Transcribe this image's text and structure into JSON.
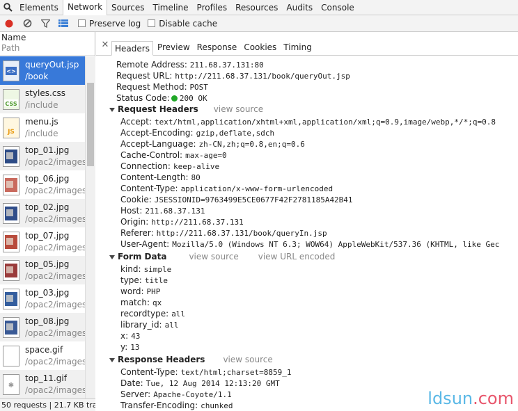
{
  "main_tabs": [
    {
      "label": "Elements"
    },
    {
      "label": "Network",
      "active": true
    },
    {
      "label": "Sources"
    },
    {
      "label": "Timeline"
    },
    {
      "label": "Profiles"
    },
    {
      "label": "Resources"
    },
    {
      "label": "Audits"
    },
    {
      "label": "Console"
    }
  ],
  "toolbar": {
    "preserve_log": "Preserve log",
    "disable_cache": "Disable cache"
  },
  "list_header": {
    "name": "Name",
    "path": "Path"
  },
  "requests": [
    {
      "name": "queryOut.jsp",
      "path": "/book",
      "icon": "html-file-icon",
      "selected": true
    },
    {
      "name": "styles.css",
      "path": "/include",
      "icon": "css-file-icon"
    },
    {
      "name": "menu.js",
      "path": "/include",
      "icon": "js-file-icon"
    },
    {
      "name": "top_01.jpg",
      "path": "/opac2/images",
      "icon": "image-thumbnail-icon"
    },
    {
      "name": "top_06.jpg",
      "path": "/opac2/images",
      "icon": "image-thumbnail-icon"
    },
    {
      "name": "top_02.jpg",
      "path": "/opac2/images",
      "icon": "image-thumbnail-icon"
    },
    {
      "name": "top_07.jpg",
      "path": "/opac2/images",
      "icon": "image-thumbnail-icon"
    },
    {
      "name": "top_05.jpg",
      "path": "/opac2/images",
      "icon": "image-thumbnail-icon"
    },
    {
      "name": "top_03.jpg",
      "path": "/opac2/images",
      "icon": "image-thumbnail-icon"
    },
    {
      "name": "top_08.jpg",
      "path": "/opac2/images",
      "icon": "image-thumbnail-icon"
    },
    {
      "name": "space.gif",
      "path": "/opac2/images",
      "icon": "image-thumbnail-icon"
    },
    {
      "name": "top_11.gif",
      "path": "/opac2/images",
      "icon": "image-thumbnail-icon"
    }
  ],
  "status_bar": "50 requests | 21.7 KB tra...",
  "detail_tabs": [
    {
      "label": "Headers",
      "active": true
    },
    {
      "label": "Preview"
    },
    {
      "label": "Response"
    },
    {
      "label": "Cookies"
    },
    {
      "label": "Timing"
    }
  ],
  "general": {
    "remote_address_k": "Remote Address:",
    "remote_address_v": "211.68.37.131:80",
    "request_url_k": "Request URL:",
    "request_url_v": "http://211.68.37.131/book/queryOut.jsp",
    "request_method_k": "Request Method:",
    "request_method_v": "POST",
    "status_code_k": "Status Code:",
    "status_code_v": "200 OK",
    "status_color": "#21a828"
  },
  "request_headers": {
    "title": "Request Headers",
    "view_source": "view source",
    "items": [
      {
        "k": "Accept:",
        "v": "text/html,application/xhtml+xml,application/xml;q=0.9,image/webp,*/*;q=0.8"
      },
      {
        "k": "Accept-Encoding:",
        "v": "gzip,deflate,sdch"
      },
      {
        "k": "Accept-Language:",
        "v": "zh-CN,zh;q=0.8,en;q=0.6"
      },
      {
        "k": "Cache-Control:",
        "v": "max-age=0"
      },
      {
        "k": "Connection:",
        "v": "keep-alive"
      },
      {
        "k": "Content-Length:",
        "v": "80"
      },
      {
        "k": "Content-Type:",
        "v": "application/x-www-form-urlencoded"
      },
      {
        "k": "Cookie:",
        "v": "JSESSIONID=9763499E5CE0677F42F2781185A42B41"
      },
      {
        "k": "Host:",
        "v": "211.68.37.131"
      },
      {
        "k": "Origin:",
        "v": "http://211.68.37.131"
      },
      {
        "k": "Referer:",
        "v": "http://211.68.37.131/book/queryIn.jsp"
      },
      {
        "k": "User-Agent:",
        "v": "Mozilla/5.0 (Windows NT 6.3; WOW64) AppleWebKit/537.36 (KHTML, like Gec"
      }
    ]
  },
  "form_data": {
    "title": "Form Data",
    "view_source": "view source",
    "view_url_encoded": "view URL encoded",
    "items": [
      {
        "k": "kind:",
        "v": "simple"
      },
      {
        "k": "type:",
        "v": "title"
      },
      {
        "k": "word:",
        "v": "PHP"
      },
      {
        "k": "match:",
        "v": "qx"
      },
      {
        "k": "recordtype:",
        "v": "all"
      },
      {
        "k": "library_id:",
        "v": "all"
      },
      {
        "k": "x:",
        "v": "43"
      },
      {
        "k": "y:",
        "v": "13"
      }
    ]
  },
  "response_headers": {
    "title": "Response Headers",
    "view_source": "view source",
    "items": [
      {
        "k": "Content-Type:",
        "v": "text/html;charset=8859_1"
      },
      {
        "k": "Date:",
        "v": "Tue, 12 Aug 2014 12:13:20 GMT"
      },
      {
        "k": "Server:",
        "v": "Apache-Coyote/1.1"
      },
      {
        "k": "Transfer-Encoding:",
        "v": "chunked"
      }
    ]
  },
  "watermark": {
    "part1": "ldsun",
    "part2": ".com"
  }
}
